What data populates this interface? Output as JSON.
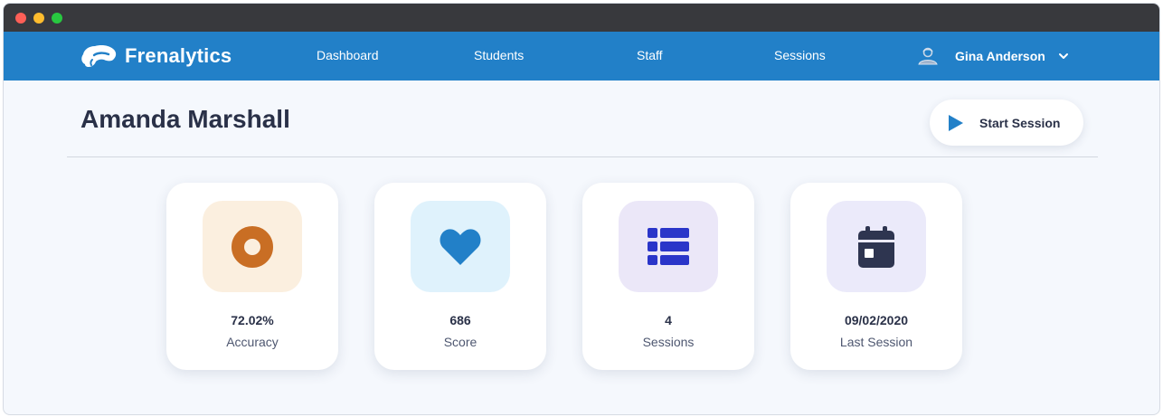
{
  "app": {
    "brand_name": "Frenalytics",
    "brand_color": "#2280c8"
  },
  "nav": {
    "links": [
      {
        "label": "Dashboard"
      },
      {
        "label": "Students"
      },
      {
        "label": "Staff"
      },
      {
        "label": "Sessions"
      }
    ],
    "user": {
      "name": "Gina Anderson",
      "avatar_icon": "user-avatar-icon",
      "menu_icon": "chevron-down-icon"
    }
  },
  "page": {
    "title": "Amanda Marshall",
    "start_button": {
      "label": "Start Session",
      "icon": "play-icon"
    }
  },
  "stats": [
    {
      "value": "72.02%",
      "label": "Accuracy",
      "icon": "target-icon",
      "bg_color": "#fbefdf",
      "icon_color": "#c96e24"
    },
    {
      "value": "686",
      "label": "Score",
      "icon": "heart-icon",
      "bg_color": "#dff2fc",
      "icon_color": "#2280c8"
    },
    {
      "value": "4",
      "label": "Sessions",
      "icon": "list-icon",
      "bg_color": "#ebe7f8",
      "icon_color": "#2a35c9"
    },
    {
      "value": "09/02/2020",
      "label": "Last Session",
      "icon": "calendar-icon",
      "bg_color": "#ebeafa",
      "icon_color": "#2e3550"
    }
  ]
}
